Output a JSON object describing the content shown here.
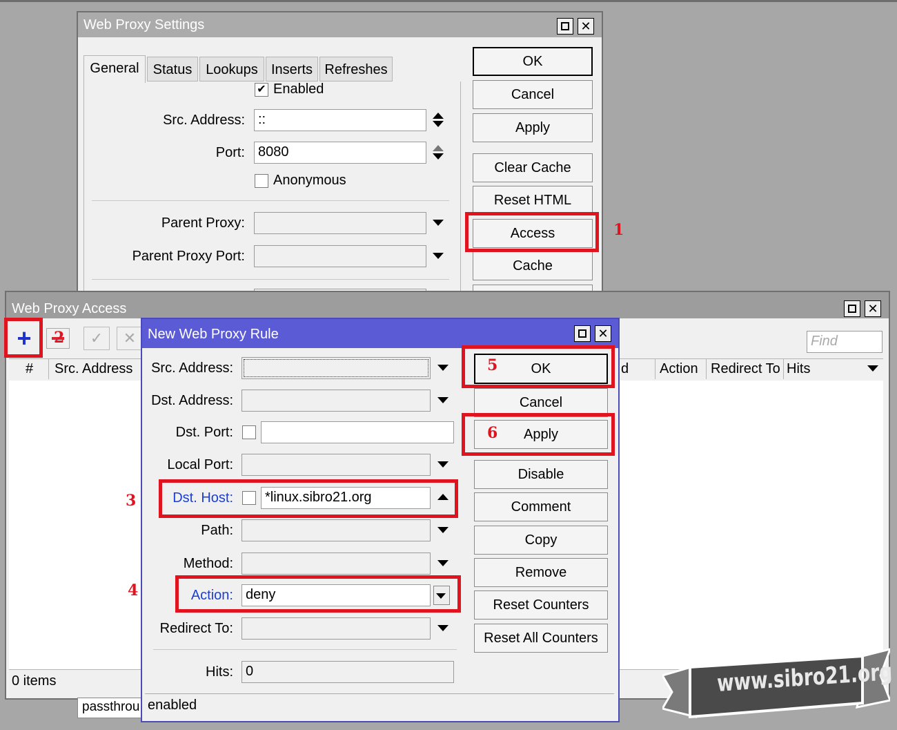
{
  "settings": {
    "title": "Web Proxy Settings",
    "tabs": [
      "General",
      "Status",
      "Lookups",
      "Inserts",
      "Refreshes"
    ],
    "enabled_label": "Enabled",
    "src_address_label": "Src. Address:",
    "src_address_value": "::",
    "port_label": "Port:",
    "port_value": "8080",
    "anonymous_label": "Anonymous",
    "parent_proxy_label": "Parent Proxy:",
    "parent_proxy_port_label": "Parent Proxy Port:",
    "buttons": [
      "OK",
      "Cancel",
      "Apply",
      "Clear Cache",
      "Reset HTML",
      "Access",
      "Cache"
    ]
  },
  "access": {
    "title": "Web Proxy Access",
    "find_placeholder": "Find",
    "columns": [
      "#",
      "Src. Address",
      "d",
      "Action",
      "Redirect To",
      "Hits"
    ],
    "status": "0 items",
    "bottom_row": "passthrou"
  },
  "rule": {
    "title": "New Web Proxy Rule",
    "src_address_label": "Src. Address:",
    "dst_address_label": "Dst. Address:",
    "dst_port_label": "Dst. Port:",
    "local_port_label": "Local Port:",
    "dst_host_label": "Dst. Host:",
    "dst_host_value": "*linux.sibro21.org",
    "path_label": "Path:",
    "method_label": "Method:",
    "action_label": "Action:",
    "action_value": "deny",
    "redirect_label": "Redirect To:",
    "hits_label": "Hits:",
    "hits_value": "0",
    "status": "enabled",
    "buttons": [
      "OK",
      "Cancel",
      "Apply",
      "Disable",
      "Comment",
      "Copy",
      "Remove",
      "Reset Counters",
      "Reset All Counters"
    ]
  },
  "annotations": [
    "1",
    "2",
    "3",
    "4",
    "5",
    "6"
  ],
  "watermark": "www.sibro21.org",
  "colors": {
    "highlight": "#e0141e",
    "rule_title_bar": "#5b5bd6",
    "field_label_blue": "#1a3fd1"
  }
}
